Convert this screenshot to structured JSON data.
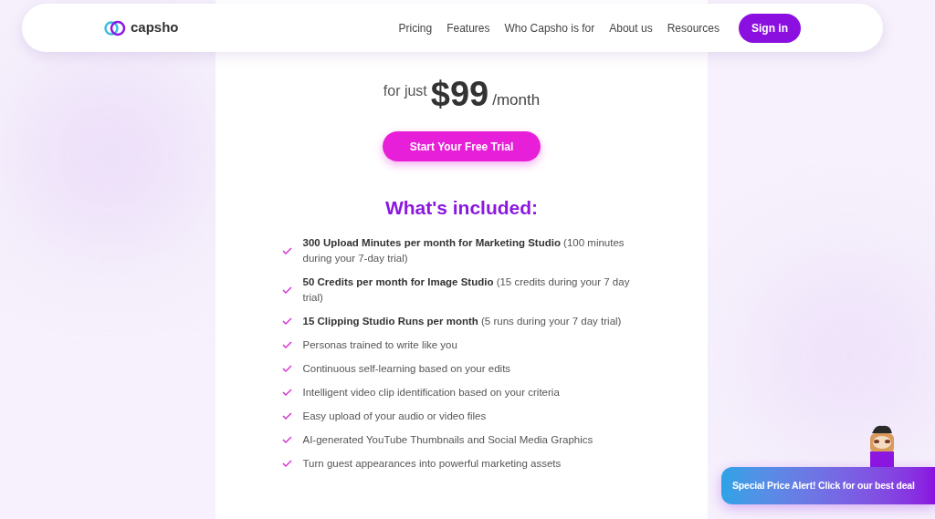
{
  "navbar": {
    "logo": "capsho",
    "links": [
      "Pricing",
      "Features",
      "Who Capsho is for",
      "About us",
      "Resources"
    ],
    "sign_in": "Sign in"
  },
  "pricing": {
    "prefix": "for just",
    "price": "$99",
    "period": "/month",
    "cta": "Start Your Free Trial"
  },
  "included": {
    "title": "What's included:",
    "items": [
      "**300 Upload Minutes per month for Marketing Studio** (100 minutes during your 7-day trial)",
      "**50 Credits per month for Image Studio** (15 credits during your 7 day trial)",
      "**15 Clipping Studio Runs per month** (5 runs during your 7 day trial)",
      "Personas trained to write like you",
      "Continuous self-learning based on your edits",
      "Intelligent video clip identification based on your criteria",
      "Easy upload of your audio or video files",
      "AI-generated YouTube Thumbnails and Social Media Graphics",
      "Turn guest appearances into powerful marketing assets"
    ]
  },
  "promo": {
    "label": "Special Price Alert! Click for our best deal"
  }
}
